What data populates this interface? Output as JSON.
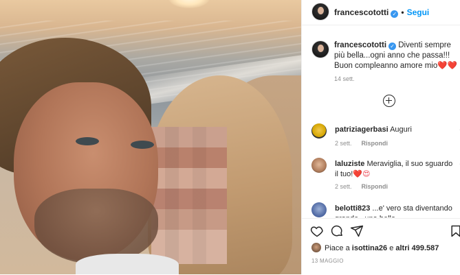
{
  "post": {
    "username": "francescototti",
    "follow_label": "Segui",
    "caption_text": "Diventi sempre più bella...ogni anno che passa!!! Buon compleanno amore mio",
    "caption_emoji": "❤️❤️",
    "caption_time": "14 sett."
  },
  "comments": [
    {
      "username": "patriziagerbasi",
      "text": "Auguri",
      "time": "2 sett.",
      "reply_label": "Rispondi"
    },
    {
      "username": "laluziste",
      "text": "Meraviglia, il suo sguardo il tuo!",
      "emoji": "❤️😍",
      "time": "2 sett.",
      "reply_label": "Rispondi"
    },
    {
      "username": "belotti823",
      "text": "...e' vero sta diventando grande...una bella"
    }
  ],
  "footer": {
    "likes_prefix": "Piace a",
    "likes_user": "isottina26",
    "likes_connector": "e",
    "likes_count": "altri 499.587",
    "date": "13 MAGGIO"
  },
  "colors": {
    "accent": "#0095f6",
    "verified": "#3897f0",
    "muted": "#8e8e8e",
    "text": "#262626",
    "heart": "#ed4956"
  },
  "icons": [
    "verified-badge-icon",
    "plus-circle-icon",
    "heart-icon",
    "comment-icon",
    "share-icon",
    "bookmark-icon"
  ]
}
